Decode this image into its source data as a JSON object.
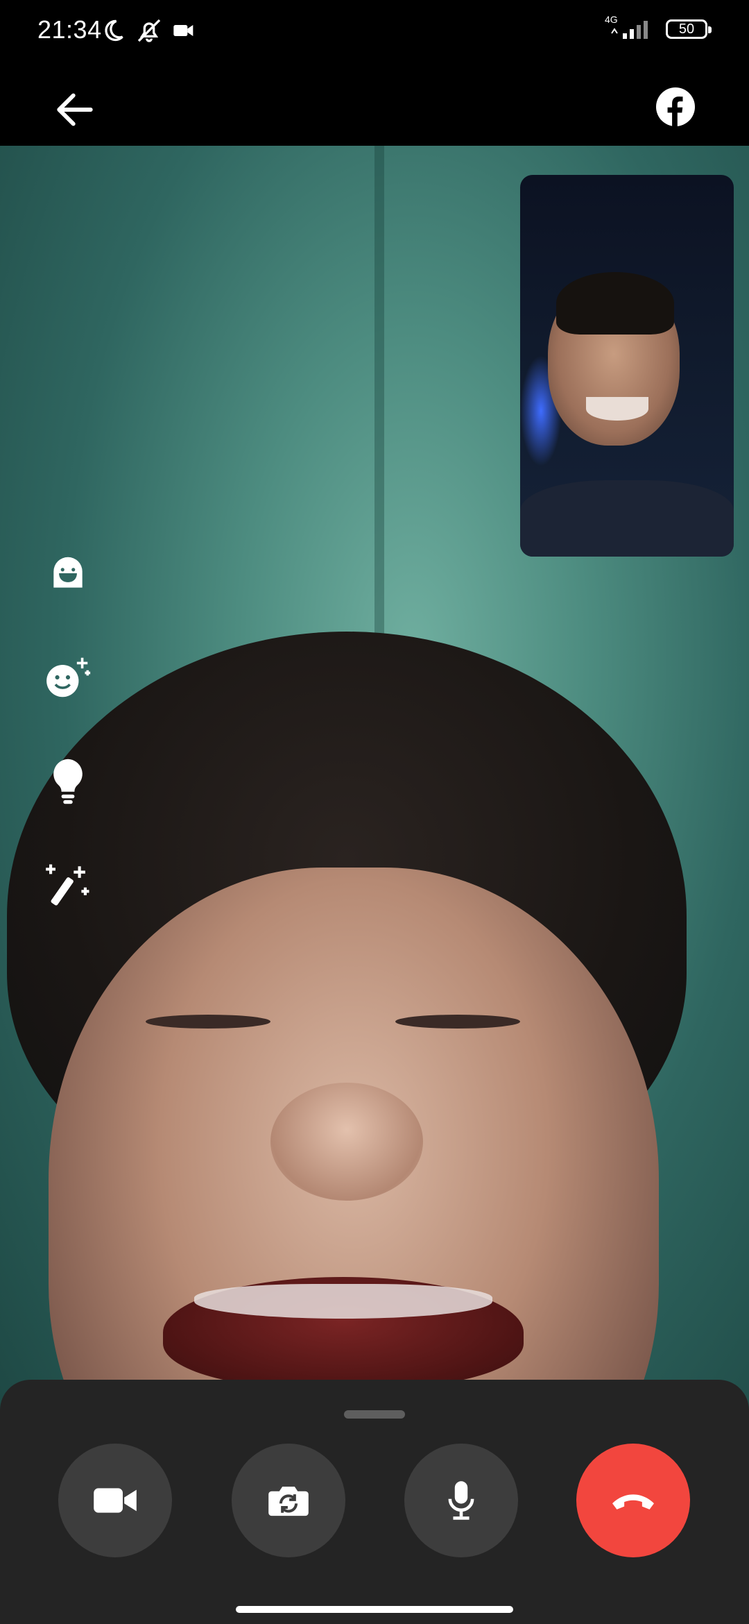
{
  "status_bar": {
    "time": "21:34",
    "network_label": "4G",
    "battery_level": "50",
    "icons": [
      "moon-icon",
      "bell-off-icon",
      "video-camera-small-icon",
      "signal-icon",
      "battery-icon"
    ]
  },
  "top_bar": {
    "back_icon": "arrow-left-icon",
    "brand_icon": "facebook-icon"
  },
  "effects": [
    "avatar-effect-icon",
    "face-sparkle-icon",
    "lightbulb-icon",
    "magic-wand-icon"
  ],
  "controls": {
    "items": [
      "video-camera-icon",
      "flip-camera-icon",
      "microphone-icon",
      "end-call-icon"
    ],
    "end_call_color": "#f2463e",
    "button_color": "#3d3d3d",
    "sheet_color": "#242424"
  }
}
